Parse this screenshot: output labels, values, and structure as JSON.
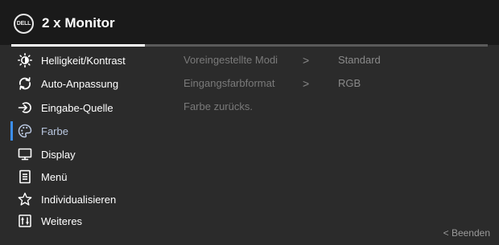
{
  "header": {
    "logo_text": "DELL",
    "title": "2 x Monitor",
    "progress_fraction": 0.28
  },
  "menu": {
    "items": [
      {
        "label": "Helligkeit/Kontrast",
        "icon": "brightness-contrast-icon"
      },
      {
        "label": "Auto-Anpassung",
        "icon": "auto-adjust-icon"
      },
      {
        "label": "Eingabe-Quelle",
        "icon": "input-source-icon"
      },
      {
        "label": "Farbe",
        "icon": "color-palette-icon",
        "selected": true
      },
      {
        "label": "Display",
        "icon": "display-icon"
      },
      {
        "label": "Menü",
        "icon": "menu-icon"
      },
      {
        "label": "Individualisieren",
        "icon": "star-icon"
      },
      {
        "label": "Weiteres",
        "icon": "others-icon"
      }
    ]
  },
  "submenu": {
    "items": [
      {
        "label": "Voreingestellte Modi",
        "arrow": ">",
        "value": "Standard"
      },
      {
        "label": "Eingangsfarbformat",
        "arrow": ">",
        "value": "RGB"
      },
      {
        "label": "Farbe zurücks."
      }
    ]
  },
  "footer": {
    "exit_label": "< Beenden"
  },
  "colors": {
    "background": "#2b2b2b",
    "header": "#1a1a1a",
    "selection_accent": "#3c8ff0",
    "disabled_text": "#7a7a7a"
  }
}
